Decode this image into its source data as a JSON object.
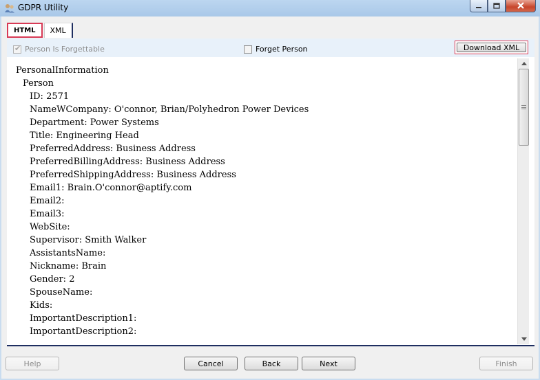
{
  "window": {
    "title": "GDPR Utility"
  },
  "tabs": [
    {
      "label": "HTML",
      "active": true
    },
    {
      "label": "XML",
      "active": false
    }
  ],
  "options": {
    "person_is_forgettable": {
      "label": "Person Is Forgettable",
      "checked": true,
      "enabled": false
    },
    "forget_person": {
      "label": "Forget Person",
      "checked": false,
      "enabled": true
    },
    "download_label": "Download XML"
  },
  "content": {
    "root": "PersonalInformation",
    "person": "Person",
    "fields": [
      "ID: 2571",
      "NameWCompany: O'connor, Brian/Polyhedron Power Devices",
      "Department: Power Systems",
      "Title: Engineering Head",
      "PreferredAddress: Business Address",
      "PreferredBillingAddress: Business Address",
      "PreferredShippingAddress: Business Address",
      "Email1: Brain.O'connor@aptify.com",
      "Email2:",
      "Email3:",
      "WebSite:",
      "Supervisor: Smith Walker",
      "AssistantsName:",
      "Nickname: Brain",
      "Gender: 2",
      "SpouseName:",
      "Kids:",
      "ImportantDescription1:",
      "ImportantDescription2:"
    ]
  },
  "buttons": {
    "help": "Help",
    "cancel": "Cancel",
    "back": "Back",
    "next": "Next",
    "finish": "Finish"
  },
  "colors": {
    "highlight": "#d83a55",
    "tab_underline": "#1e2e60"
  }
}
